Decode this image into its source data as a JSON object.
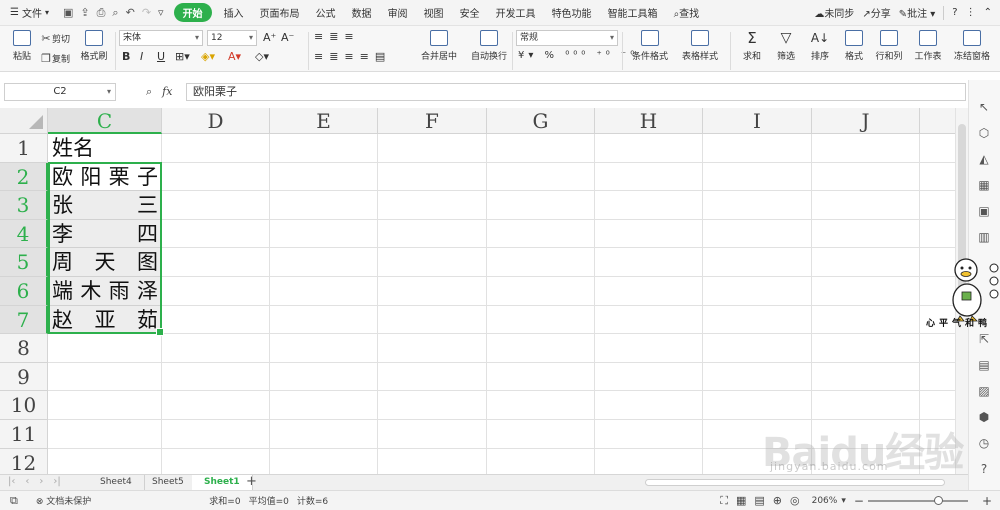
{
  "menubar": {
    "file_label": "文件",
    "tabs": [
      "开始",
      "插入",
      "页面布局",
      "公式",
      "数据",
      "审阅",
      "视图",
      "安全",
      "开发工具",
      "特色功能",
      "智能工具箱"
    ],
    "active_tab": "开始",
    "search_label": "查找",
    "sync_label": "未同步",
    "share_label": "分享",
    "comment_label": "批注",
    "help": "?"
  },
  "ribbon": {
    "paste": "粘贴",
    "cut": "剪切",
    "copy": "复制",
    "format_painter": "格式刷",
    "font_name": "宋体",
    "font_size": "12",
    "merge_center": "合并居中",
    "wrap_text": "自动换行",
    "number_format": "常规",
    "cond_format": "条件格式",
    "table_style": "表格样式",
    "sum": "求和",
    "filter": "筛选",
    "sort": "排序",
    "format": "格式",
    "row_col": "行和列",
    "worksheet": "工作表",
    "freeze": "冻结窗格"
  },
  "formula_bar": {
    "cell_ref": "C2",
    "fx": "fx",
    "content": "欧阳栗子"
  },
  "grid": {
    "columns": [
      "C",
      "D",
      "E",
      "F",
      "G",
      "H",
      "I",
      "J"
    ],
    "selected_column": "C",
    "rows": [
      "1",
      "2",
      "3",
      "4",
      "5",
      "6",
      "7",
      "8",
      "9",
      "10",
      "11",
      "12"
    ],
    "header_cell": "姓名",
    "names": [
      [
        "欧",
        "阳",
        "栗",
        "子"
      ],
      [
        "张",
        "三"
      ],
      [
        "李",
        "四"
      ],
      [
        "周",
        "天",
        "图"
      ],
      [
        "端",
        "木",
        "雨",
        "泽"
      ],
      [
        "赵",
        "亚",
        "茹"
      ]
    ]
  },
  "mascot": {
    "caption": "心平气和鸭"
  },
  "sheets": {
    "tabs": [
      "Sheet4",
      "Sheet5",
      "Sheet1"
    ],
    "active": "Sheet1",
    "add": "+"
  },
  "status": {
    "protect": "文档未保护",
    "sum": "求和=0",
    "avg": "平均值=0",
    "count": "计数=6",
    "zoom": "206%"
  },
  "watermark": {
    "brand": "Baidu经验",
    "url": "jingyan.baidu.com"
  },
  "colors": {
    "accent": "#2db04c",
    "selection_border": "#2db04c"
  }
}
